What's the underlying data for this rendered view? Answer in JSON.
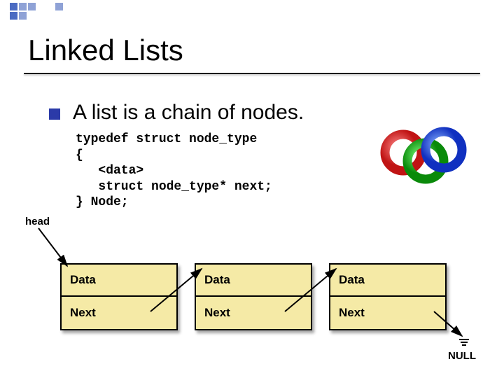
{
  "title": "Linked Lists",
  "bullet": "A list is a chain of nodes.",
  "code": {
    "l1": "typedef struct node_type",
    "l2": "{",
    "l3": "   <data>",
    "l4": "   struct node_type* next;",
    "l5": "} Node;"
  },
  "head_label": "head",
  "node_fields": {
    "data": "Data",
    "next": "Next"
  },
  "null_label": "NULL",
  "chart_data": {
    "type": "diagram",
    "title": "Singly linked list with three nodes",
    "nodes": [
      {
        "id": 1,
        "fields": [
          "Data",
          "Next"
        ]
      },
      {
        "id": 2,
        "fields": [
          "Data",
          "Next"
        ]
      },
      {
        "id": 3,
        "fields": [
          "Data",
          "Next"
        ]
      }
    ],
    "edges": [
      {
        "from": "head",
        "to": 1
      },
      {
        "from": 1,
        "to": 2
      },
      {
        "from": 2,
        "to": 3
      },
      {
        "from": 3,
        "to": "NULL"
      }
    ]
  }
}
